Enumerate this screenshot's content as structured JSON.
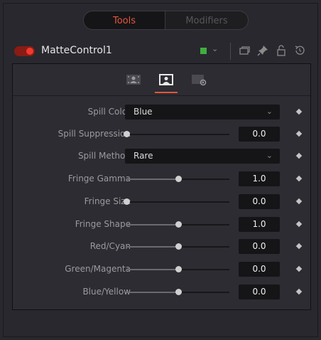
{
  "tabs": {
    "tools": "Tools",
    "modifiers": "Modifiers"
  },
  "node": {
    "name": "MatteControl1",
    "enabled": true,
    "color": "#3fae3f"
  },
  "header_icons": [
    "chevron-down-icon",
    "view-icon",
    "pin-icon",
    "lock-icon",
    "reset-icon"
  ],
  "subtabs": [
    "controls-icon",
    "spill-icon",
    "settings-icon"
  ],
  "controls": [
    {
      "label": "Spill Color",
      "type": "dropdown",
      "value": "Blue"
    },
    {
      "label": "Spill Suppression",
      "type": "slider",
      "value": "0.0",
      "fraction": 0.0
    },
    {
      "label": "Spill Method",
      "type": "dropdown",
      "value": "Rare"
    },
    {
      "label": "Fringe Gamma",
      "type": "slider",
      "value": "1.0",
      "fraction": 0.5
    },
    {
      "label": "Fringe Size",
      "type": "slider",
      "value": "0.0",
      "fraction": 0.0
    },
    {
      "label": "Fringe Shape",
      "type": "slider",
      "value": "1.0",
      "fraction": 0.5
    },
    {
      "label": "Red/Cyan",
      "type": "slider",
      "value": "0.0",
      "fraction": 0.5
    },
    {
      "label": "Green/Magenta",
      "type": "slider",
      "value": "0.0",
      "fraction": 0.5
    },
    {
      "label": "Blue/Yellow",
      "type": "slider",
      "value": "0.0",
      "fraction": 0.5
    }
  ]
}
